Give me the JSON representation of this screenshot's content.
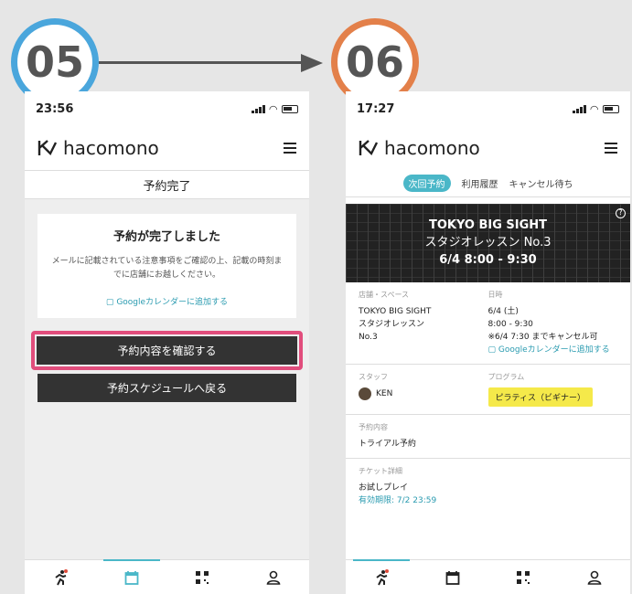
{
  "steps": {
    "left": "05",
    "right": "06"
  },
  "colors": {
    "step_left": "#4aa6dc",
    "step_right": "#e3804a",
    "highlight": "#e14d7c",
    "accent": "#4ab7c8",
    "tag": "#f5e94a"
  },
  "phone_a": {
    "time": "23:56",
    "brand": "hacomono",
    "page_title": "予約完了",
    "card_title": "予約が完了しました",
    "card_body": "メールに記載されている注意事項をご確認の上、記載の時刻までに店舗にお越しください。",
    "gcal_link": "Googleカレンダーに追加する",
    "confirm_button": "予約内容を確認する",
    "back_button": "予約スケジュールへ戻る"
  },
  "phone_b": {
    "time": "17:27",
    "brand": "hacomono",
    "segments": [
      "次回予約",
      "利用履歴",
      "キャンセル待ち"
    ],
    "hero": {
      "venue": "TOKYO BIG SIGHT",
      "lesson": "スタジオレッスン No.3",
      "datetime": "6/4  8:00 - 9:30"
    },
    "store_label": "店舗・スペース",
    "store_lines": [
      "TOKYO BIG SIGHT",
      "スタジオレッスン",
      "No.3"
    ],
    "date_label": "日時",
    "date_lines": [
      "6/4 (土)",
      "8:00 - 9:30",
      "※6/4 7:30 までキャンセル可"
    ],
    "gcal_link": "Googleカレンダーに追加する",
    "staff_label": "スタッフ",
    "staff_name": "KEN",
    "program_label": "プログラム",
    "program_name": "ピラティス（ビギナー）",
    "content_label": "予約内容",
    "content_value": "トライアル予約",
    "ticket_label": "チケット詳細",
    "ticket_name": "お試しプレイ",
    "ticket_expiry": "有効期限: 7/2 23:59"
  },
  "tabs": [
    "run-icon",
    "calendar-icon",
    "qr-icon",
    "user-icon"
  ]
}
